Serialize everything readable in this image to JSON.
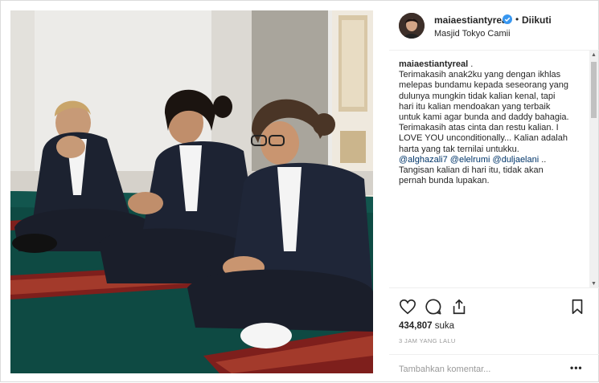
{
  "header": {
    "username": "maiaestiantyreal",
    "separator": "•",
    "follow_status": "Diikuti",
    "location": "Masjid Tokyo Camii"
  },
  "caption": {
    "username": "maiaestiantyreal",
    "lines": [
      " .",
      "Terimakasih anak2ku yang dengan ikhlas",
      "melepas bundamu kepada seseorang yang",
      "dulunya mungkin tidak kalian kenal, tapi",
      "hari itu kalian mendoakan yang terbaik",
      "untuk kami agar bunda and daddy bahagia.",
      "Terimakasih atas cinta dan restu kalian. I",
      "LOVE YOU unconditionally... Kalian adalah",
      "harta yang tak ternilai untukku."
    ],
    "mentions": [
      "@alghazali7",
      "@elelrumi",
      "@duljaelani"
    ],
    "mentions_suffix": " ..",
    "closing_lines": [
      "Tangisan kalian di hari itu, tidak akan",
      "pernah bunda lupakan."
    ]
  },
  "likes": {
    "count": "434,807",
    "unit": "suka"
  },
  "timestamp": "3 JAM YANG LALU",
  "comment": {
    "placeholder": "Tambahkan komentar..."
  },
  "icons": {
    "like": "heart-icon",
    "comment": "speech-bubble-icon",
    "share": "share-icon",
    "save": "bookmark-icon",
    "more": "more-dots-icon",
    "verified": "verified-badge-icon"
  },
  "more_label": "•••",
  "colors": {
    "verified": "#3897f0",
    "mention": "#003569",
    "muted": "#999999"
  }
}
